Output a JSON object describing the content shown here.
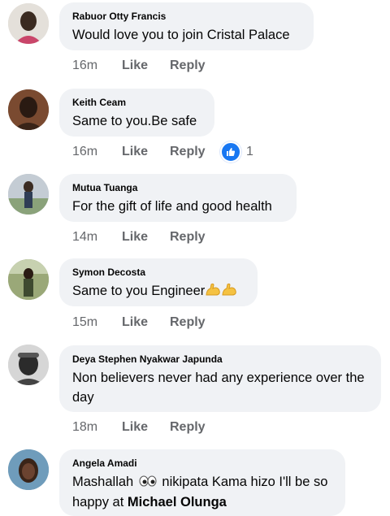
{
  "colors": {
    "bubble": "#f0f2f5",
    "meta": "#65676b",
    "like_reaction": "#1877f2"
  },
  "comments": [
    {
      "author": "Rabuor Otty Francis",
      "text": "Would love you to join Cristal Palace",
      "time": "16m",
      "like": "Like",
      "reply": "Reply"
    },
    {
      "author": "Keith Ceam",
      "text": "Same to you.Be safe",
      "time": "16m",
      "like": "Like",
      "reply": "Reply",
      "reactions": {
        "icon": "thumbs-up-icon",
        "count": "1"
      }
    },
    {
      "author": "Mutua Tuanga",
      "text": "For the gift of life and good health",
      "time": "14m",
      "like": "Like",
      "reply": "Reply"
    },
    {
      "author": "Symon Decosta",
      "text": "Same to you Engineer",
      "emojis": [
        "flexed-biceps-icon",
        "flexed-biceps-icon"
      ],
      "time": "15m",
      "like": "Like",
      "reply": "Reply"
    },
    {
      "author": "Deya Stephen Nyakwar Japunda",
      "text_line1": "Non believers never had any experience over the",
      "text_line2": "day",
      "time": "18m",
      "like": "Like",
      "reply": "Reply"
    },
    {
      "author": "Angela Amadi",
      "text_part1": "Mashallah",
      "emoji": "eyes-icon",
      "text_part2": "nikipata Kama hizo I'll be so",
      "text_part3": "happy at",
      "mention": "Michael Olunga"
    }
  ]
}
